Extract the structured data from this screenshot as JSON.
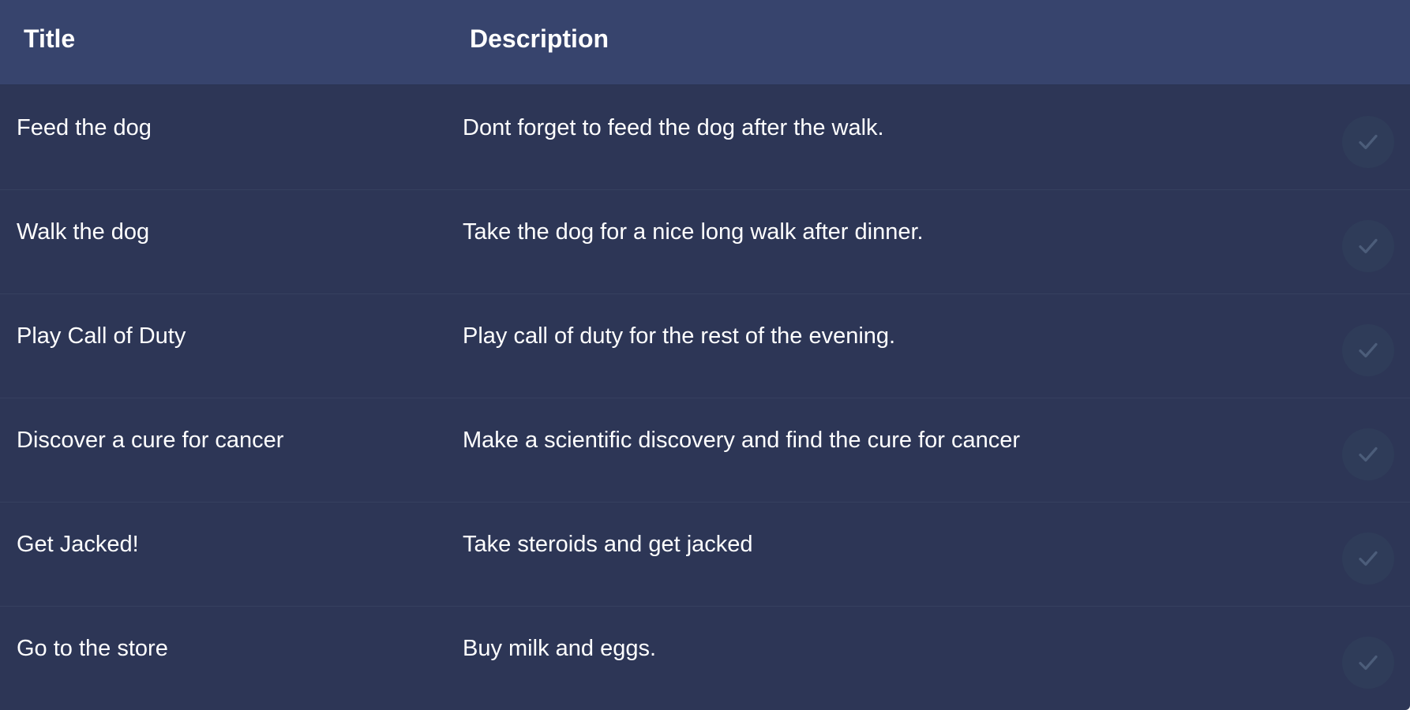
{
  "header": {
    "title_col": "Title",
    "description_col": "Description"
  },
  "rows": [
    {
      "title": "Feed the dog",
      "description": "Dont forget to feed the dog after the walk.",
      "action_icon": "check-icon"
    },
    {
      "title": "Walk the dog",
      "description": "Take the dog for a nice long walk after dinner.",
      "action_icon": "check-icon"
    },
    {
      "title": "Play Call of Duty",
      "description": "Play call of duty for the rest of the evening.",
      "action_icon": "check-icon"
    },
    {
      "title": "Discover a cure for cancer",
      "description": "Make a scientific discovery and find the cure for cancer",
      "action_icon": "check-icon"
    },
    {
      "title": "Get Jacked!",
      "description": "Take steroids and get jacked",
      "action_icon": "check-icon"
    },
    {
      "title": "Go to the store",
      "description": "Buy milk and eggs.",
      "action_icon": "check-icon"
    }
  ],
  "colors": {
    "header_bg": "#37446d",
    "row_bg": "#2d3656",
    "check_bg": "#2f3c59",
    "check_stroke": "#4c5d7a"
  }
}
